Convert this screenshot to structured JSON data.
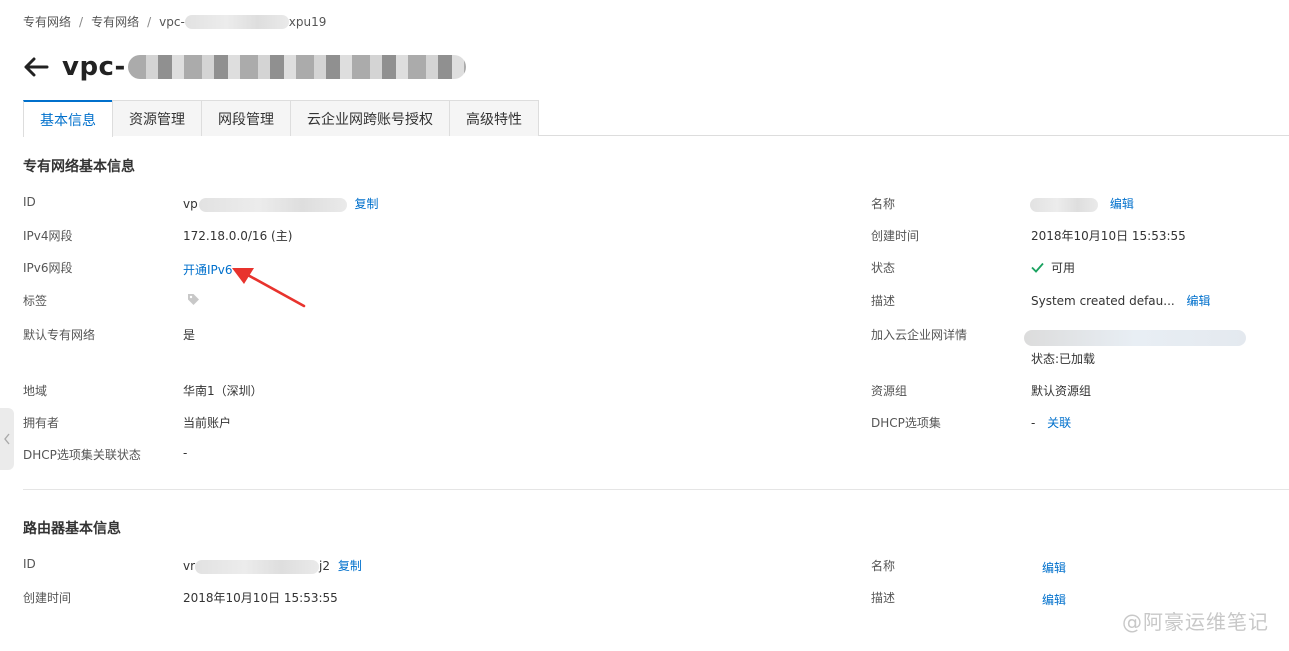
{
  "breadcrumb": {
    "item1": "专有网络",
    "item2": "专有网络",
    "item3_prefix": "vpc-",
    "item3_suffix": "xpu19",
    "sep": "/"
  },
  "header": {
    "title_prefix": "vpc-"
  },
  "tabs": [
    {
      "label": "基本信息"
    },
    {
      "label": "资源管理"
    },
    {
      "label": "网段管理"
    },
    {
      "label": "云企业网跨账号授权"
    },
    {
      "label": "高级特性"
    }
  ],
  "vpc_section": {
    "title": "专有网络基本信息",
    "id_label": "ID",
    "id_prefix": "vp",
    "copy_label": "复制",
    "ipv4_label": "IPv4网段",
    "ipv4_value": "172.18.0.0/16 (主)",
    "ipv6_label": "IPv6网段",
    "ipv6_link": "开通IPv6",
    "tag_label": "标签",
    "default_label": "默认专有网络",
    "default_value": "是",
    "region_label": "地域",
    "region_value": "华南1（深圳）",
    "owner_label": "拥有者",
    "owner_value": "当前账户",
    "dhcp_status_label": "DHCP选项集关联状态",
    "dhcp_status_value": "-",
    "name_label": "名称",
    "edit_label": "编辑",
    "created_label": "创建时间",
    "created_value": "2018年10月10日 15:53:55",
    "status_label": "状态",
    "status_value": "可用",
    "desc_label": "描述",
    "desc_value": "System created defau...",
    "cen_label": "加入云企业网详情",
    "cen_status": "状态:已加载",
    "rg_label": "资源组",
    "rg_value": "默认资源组",
    "dhcp_label": "DHCP选项集",
    "dhcp_value": "-",
    "dhcp_link": "关联"
  },
  "router_section": {
    "title": "路由器基本信息",
    "id_label": "ID",
    "id_prefix": "vr",
    "id_suffix": "j2",
    "copy_label": "复制",
    "created_label": "创建时间",
    "created_value": "2018年10月10日 15:53:55",
    "name_label": "名称",
    "desc_label": "描述",
    "edit_label": "编辑"
  },
  "watermark": "@阿豪运维笔记",
  "colors": {
    "link": "#0070cc",
    "success": "#1aa260",
    "annotation": "#e8332d"
  }
}
